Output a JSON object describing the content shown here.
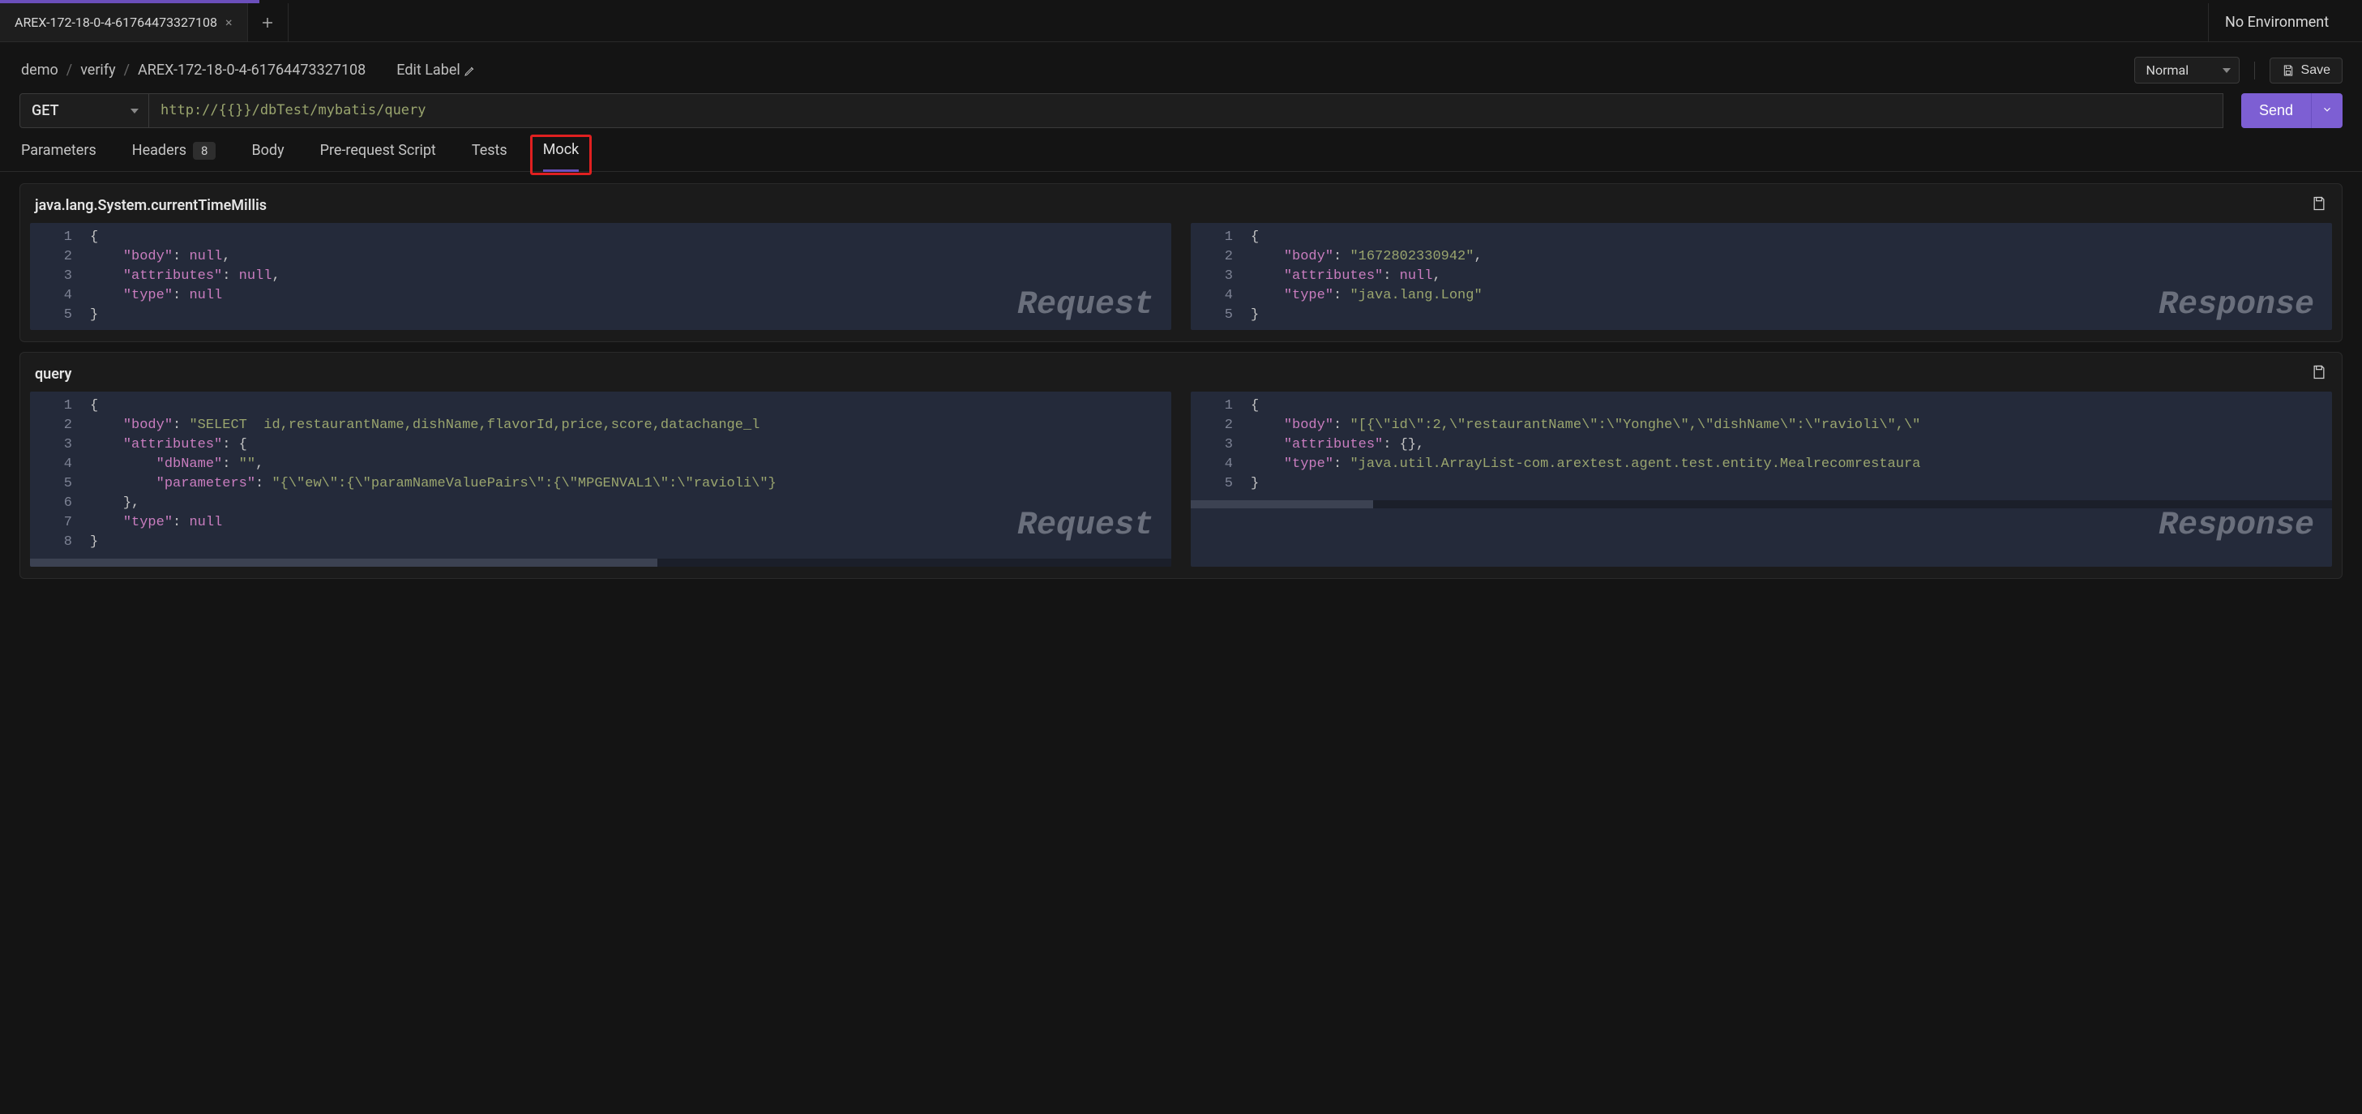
{
  "top": {
    "tab_title": "AREX-172-18-0-4-61764473327108",
    "environment": "No Environment"
  },
  "breadcrumb": {
    "a": "demo",
    "b": "verify",
    "c": "AREX-172-18-0-4-61764473327108"
  },
  "toolbar": {
    "edit_label": "Edit Label",
    "mode": "Normal",
    "save_label": "Save"
  },
  "request": {
    "method": "GET",
    "url": "http://{{}}/dbTest/mybatis/query",
    "send_label": "Send"
  },
  "tabs": {
    "parameters": "Parameters",
    "headers": "Headers",
    "headers_count": "8",
    "body": "Body",
    "prerequest": "Pre-request Script",
    "tests": "Tests",
    "mock": "Mock"
  },
  "labels": {
    "request_watermark": "Request",
    "response_watermark": "Response"
  },
  "mocks": [
    {
      "title": "java.lang.System.currentTimeMillis",
      "request": {
        "lines": [
          "1",
          "2",
          "3",
          "4",
          "5"
        ],
        "code_html": "<span class='p'>{</span>\n    <span class='k'>\"body\"</span><span class='p'>: </span><span class='nl'>null</span><span class='p'>,</span>\n    <span class='k'>\"attributes\"</span><span class='p'>: </span><span class='nl'>null</span><span class='p'>,</span>\n    <span class='k'>\"type\"</span><span class='p'>: </span><span class='nl'>null</span>\n<span class='p'>}</span>"
      },
      "response": {
        "lines": [
          "1",
          "2",
          "3",
          "4",
          "5"
        ],
        "code_html": "<span class='p'>{</span>\n    <span class='k'>\"body\"</span><span class='p'>: </span><span class='s'>\"1672802330942\"</span><span class='p'>,</span>\n    <span class='k'>\"attributes\"</span><span class='p'>: </span><span class='nl'>null</span><span class='p'>,</span>\n    <span class='k'>\"type\"</span><span class='p'>: </span><span class='s'>\"java.lang.Long\"</span>\n<span class='p'>}</span>"
      }
    },
    {
      "title": "query",
      "request": {
        "lines": [
          "1",
          "2",
          "3",
          "4",
          "5",
          "6",
          "7",
          "8"
        ],
        "code_html": "<span class='p'>{</span>\n    <span class='k'>\"body\"</span><span class='p'>: </span><span class='s'>\"SELECT  id,restaurantName,dishName,flavorId,price,score,datachange_l</span>\n    <span class='k'>\"attributes\"</span><span class='p'>: {</span>\n        <span class='k'>\"dbName\"</span><span class='p'>: </span><span class='s'>\"\"</span><span class='p'>,</span>\n        <span class='k'>\"parameters\"</span><span class='p'>: </span><span class='s'>\"{\\\"ew\\\":{\\\"paramNameValuePairs\\\":{\\\"MPGENVAL1\\\":\\\"ravioli\\\"}</span>\n    <span class='p'>},</span>\n    <span class='k'>\"type\"</span><span class='p'>: </span><span class='nl'>null</span>\n<span class='p'>}</span>"
      },
      "response": {
        "lines": [
          "1",
          "2",
          "3",
          "4",
          "5"
        ],
        "code_html": "<span class='p'>{</span>\n    <span class='k'>\"body\"</span><span class='p'>: </span><span class='s'>\"[{\\\"id\\\":2,\\\"restaurantName\\\":\\\"Yonghe\\\",\\\"dishName\\\":\\\"ravioli\\\",\\\"</span>\n    <span class='k'>\"attributes\"</span><span class='p'>: {},</span>\n    <span class='k'>\"type\"</span><span class='p'>: </span><span class='s'>\"java.util.ArrayList-com.arextest.agent.test.entity.Mealrecomrestaura</span>\n<span class='p'>}</span>"
      }
    }
  ]
}
